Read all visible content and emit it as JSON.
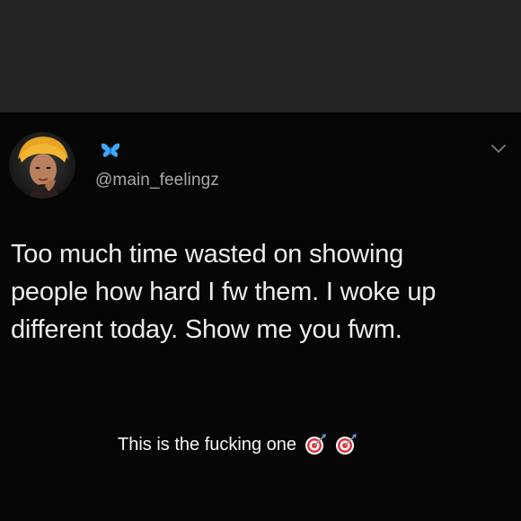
{
  "tweet": {
    "handle": "@main_feelingz",
    "name_icon": "butterfly-icon",
    "menu_icon": "chevron-down-icon",
    "text_lines": [
      "Too much time wasted on showing",
      "people how hard I fw them. I woke up",
      "different today. Show me you fwm."
    ]
  },
  "caption": {
    "text": "This is the fucking one",
    "icons": [
      "direct-hit-icon",
      "direct-hit-icon"
    ]
  },
  "colors": {
    "background": "#000000",
    "top_band": "#242424",
    "handle_gray": "#a9a9a9",
    "butterfly_blue": "#3ea6ff"
  }
}
